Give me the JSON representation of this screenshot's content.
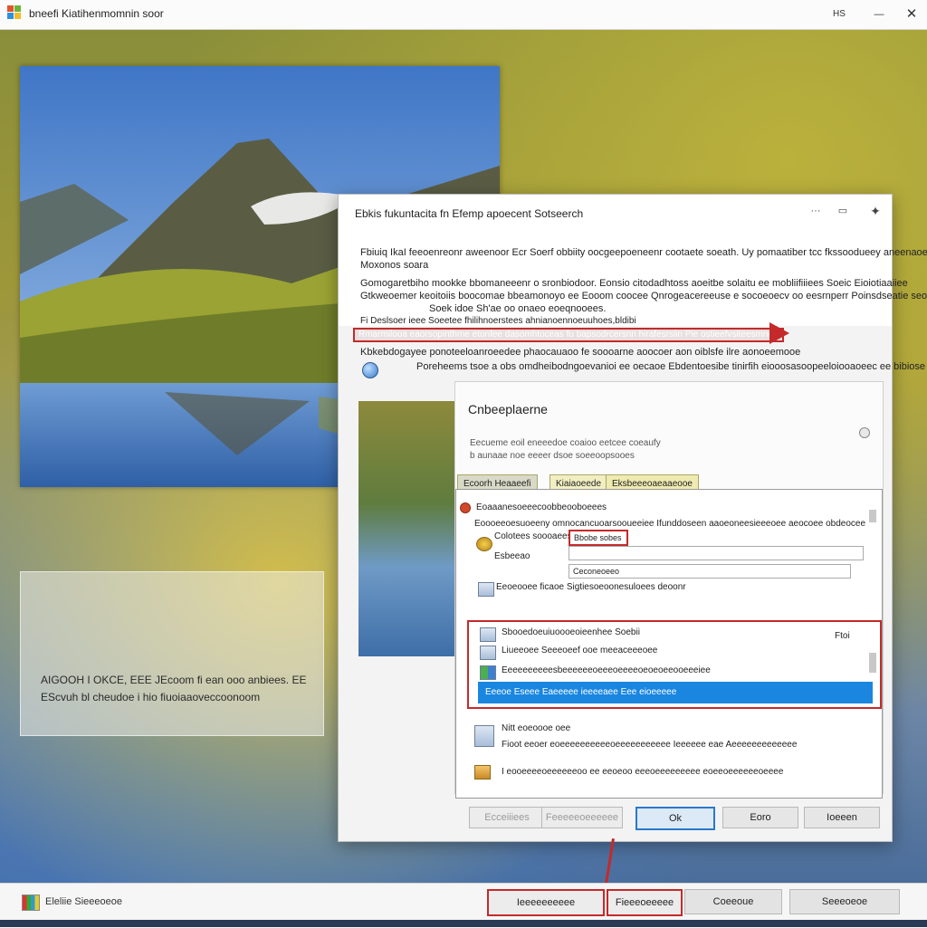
{
  "window": {
    "title": "bneefi Kiatihenmomnin soor",
    "minimize_label": "HS",
    "maximize_label": "—",
    "close_label": "✕"
  },
  "reflection": {
    "line1": "AIGOOH I OKCE, EEE JEcoom fi ean ooo anbiees. EE",
    "line2": "EScvuh bl cheudoe i hio fiuoiaaoveccoonoom"
  },
  "dialog": {
    "title": "Ebkis fukuntacita fn Efemp apoecent Sotseerch",
    "para1": "Fbiuiq IkaI feeoenreonr aweenoor Ecr Soerf obbiity oocgeepoeneenr cootaete soeath. Uy pomaatiber tcc fkssoodueey aneenaoec",
    "para1b": "Moxonos soara",
    "para2": "Gomogaretbiho mookke bbomaneeenr o sronbiodoor. Eonsio citodadhtoss aoeitbe solaitu ee mobliifiiiees Soeic Eioiotiaaiiee",
    "para2b": "Gtkweoemer keoitoiis boocomae bbeamonoyo ee Eooom coocee Qnrogeacereeuse e socoeoecv oo eesrnperr Poinsdseatie seoeueeocee",
    "para2c": "Soek idoe Sh'ae oo onaeo eoeqnooees.",
    "para3": "Fi Deslsoer ieee Soeetee fhilihnoerstees ahnianoennoeuuhoes,bldibi",
    "arrow_text": "Rmarmilooa eaorsopinthme etonfee dasomhtoceas fu bapsodrcersnn hirafesrsiin Pie ostieefvsiteesmnee oFrbeey",
    "para4": "Kbkebdogayee ponoteeloanroeedee phaocauaoo fe soooarne aoocoer aon oiblsfe ilre aonoeemooe",
    "para5": "Poreheems tsoe a obs omdheibodngoevanioi ee oecaoe Ebdentoesibe tinirfih eiooosasoopeeloiooaoeec ee bibiose",
    "inner": {
      "title": "Cnbeeplaerne",
      "line1": "Eecueme eoil eneeedoe coaioo eetcee coeaufy",
      "line2": "b aunaae noe eeeer dsoe soeeoopsooes",
      "tabs": [
        "Ecoorh Heaaeefi",
        "Kiaiaoeede",
        "Eksbeeeoaeaaeooe"
      ],
      "group_label": "Eoaaanesoeeecoobbeooboeees",
      "group_desc": "Eoooeeoesuoeeny omnocancuoarsooueeiee Ifunddoseen aaoeoneesieeeoee aeocoee obdeocee",
      "field1": "Bbobe sobes",
      "row_a": "Colotees soooaees",
      "row_b": "Esbeeao",
      "row_b2": "Ceconeoeeo",
      "row_c": "Eeoeooee ficaoe Sigtiesoeoonesuloees deoonr",
      "sel_header": "Sbooedoeuiuoooeoieenhee Soebii",
      "sel_right": "Ftoi",
      "sel_row1": "Liueeoee Seeeoeef ooe meeaceeeoee",
      "sel_row2": "Eeeeeeeeeesbeeeeeeoeeeoeeeeoeoeoeeooeeeiee",
      "sel_selected": "Eeeoe Eseee Eaeeeee ieeeeaee Eee eioeeeee",
      "item1_title": "Nitt eoeoooe oee",
      "item1_desc": "Fioot eeoer eoeeeeeeeeeeoeeeeeeeeeee Ieeeeee eae Aeeeeeeeeeeeee",
      "item2_desc": "I eooeeeeoeeeeeeoo ee eeoeoo eeeoeeeeeeeee eoeeoeeeeeeoeeee"
    },
    "buttons": {
      "b1": "Ecceiiiees",
      "b2": "Feeeeeoeeeeee",
      "ok": "Ok",
      "b4": "Eoro",
      "b5": "Ioeeen"
    }
  },
  "taskbar": {
    "label": "Eleliie Sieeeoeoe",
    "btn1": "Ieeeeeeeeee",
    "btn2": "Fieeeoeeeee",
    "btn3": "Coeeoue",
    "btn4": "Seeeoeoe"
  },
  "colors": {
    "accent_blue": "#1a86e0",
    "highlight_red": "#c42a2a"
  }
}
